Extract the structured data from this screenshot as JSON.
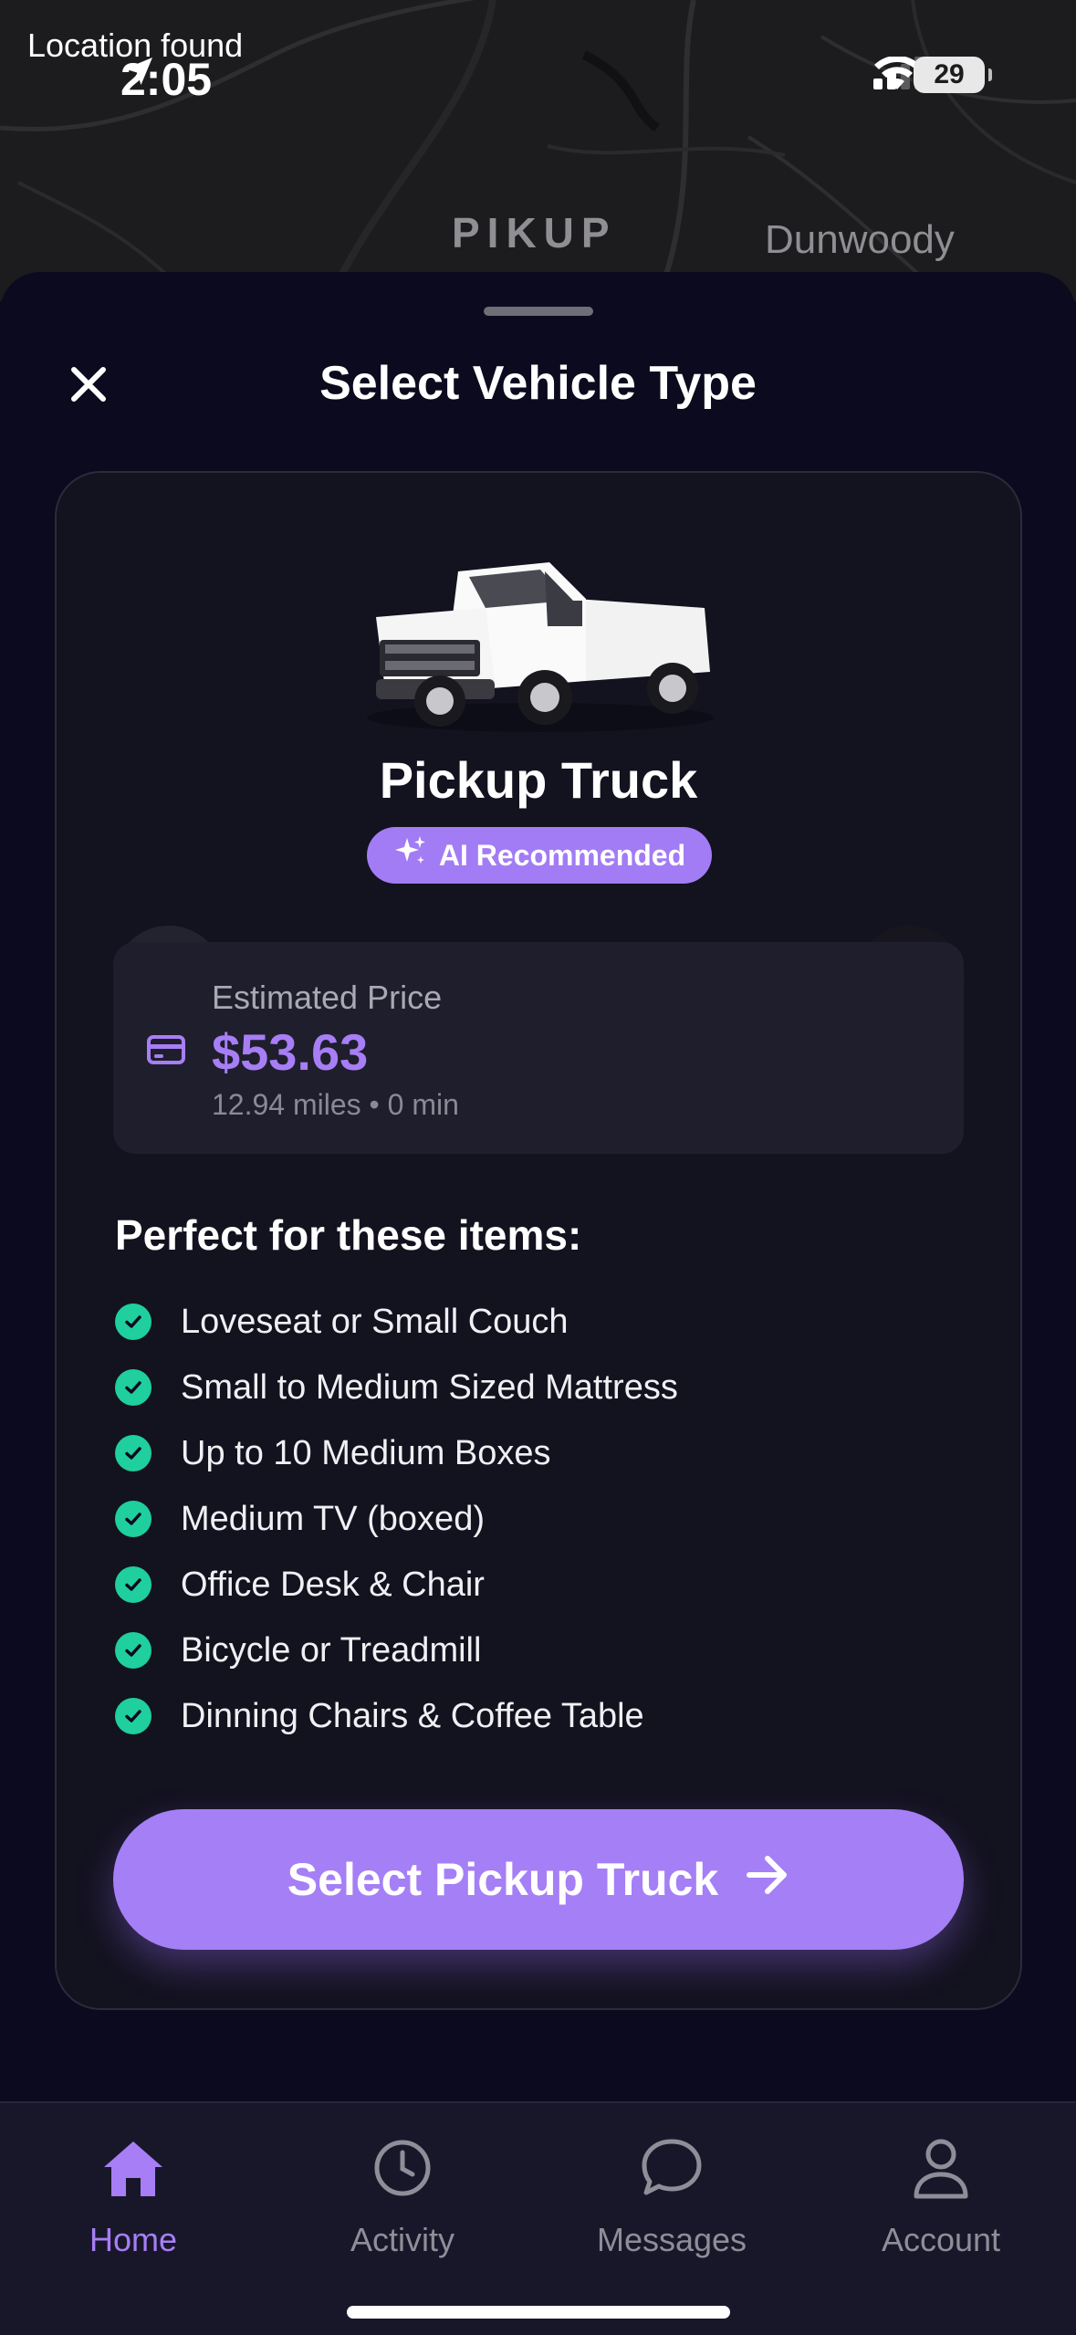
{
  "status_bar": {
    "location_text": "Location found",
    "time": "2:05",
    "battery": "29"
  },
  "map": {
    "brand": "PIKUP",
    "city": "Dunwoody"
  },
  "sheet": {
    "title": "Select Vehicle Type"
  },
  "vehicle": {
    "name": "Pickup Truck",
    "badge": "AI Recommended"
  },
  "price": {
    "label": "Estimated Price",
    "value": "$53.63",
    "meta": "12.94 miles • 0 min"
  },
  "items_section": {
    "title": "Perfect for these items:",
    "items": [
      "Loveseat or Small Couch",
      "Small to Medium Sized Mattress",
      "Up to 10 Medium Boxes",
      "Medium TV (boxed)",
      "Office Desk & Chair",
      "Bicycle or Treadmill",
      "Dinning Chairs & Coffee Table"
    ]
  },
  "cta": {
    "label": "Select Pickup Truck"
  },
  "tabbar": {
    "tabs": [
      {
        "label": "Home",
        "icon": "home-icon",
        "active": true
      },
      {
        "label": "Activity",
        "icon": "clock-icon",
        "active": false
      },
      {
        "label": "Messages",
        "icon": "chat-bubble-icon",
        "active": false
      },
      {
        "label": "Account",
        "icon": "person-icon",
        "active": false
      }
    ]
  },
  "colors": {
    "accent": "#a57ff6",
    "check": "#1fcf9e",
    "background": "#0b0a1e",
    "card": "#13121f"
  }
}
